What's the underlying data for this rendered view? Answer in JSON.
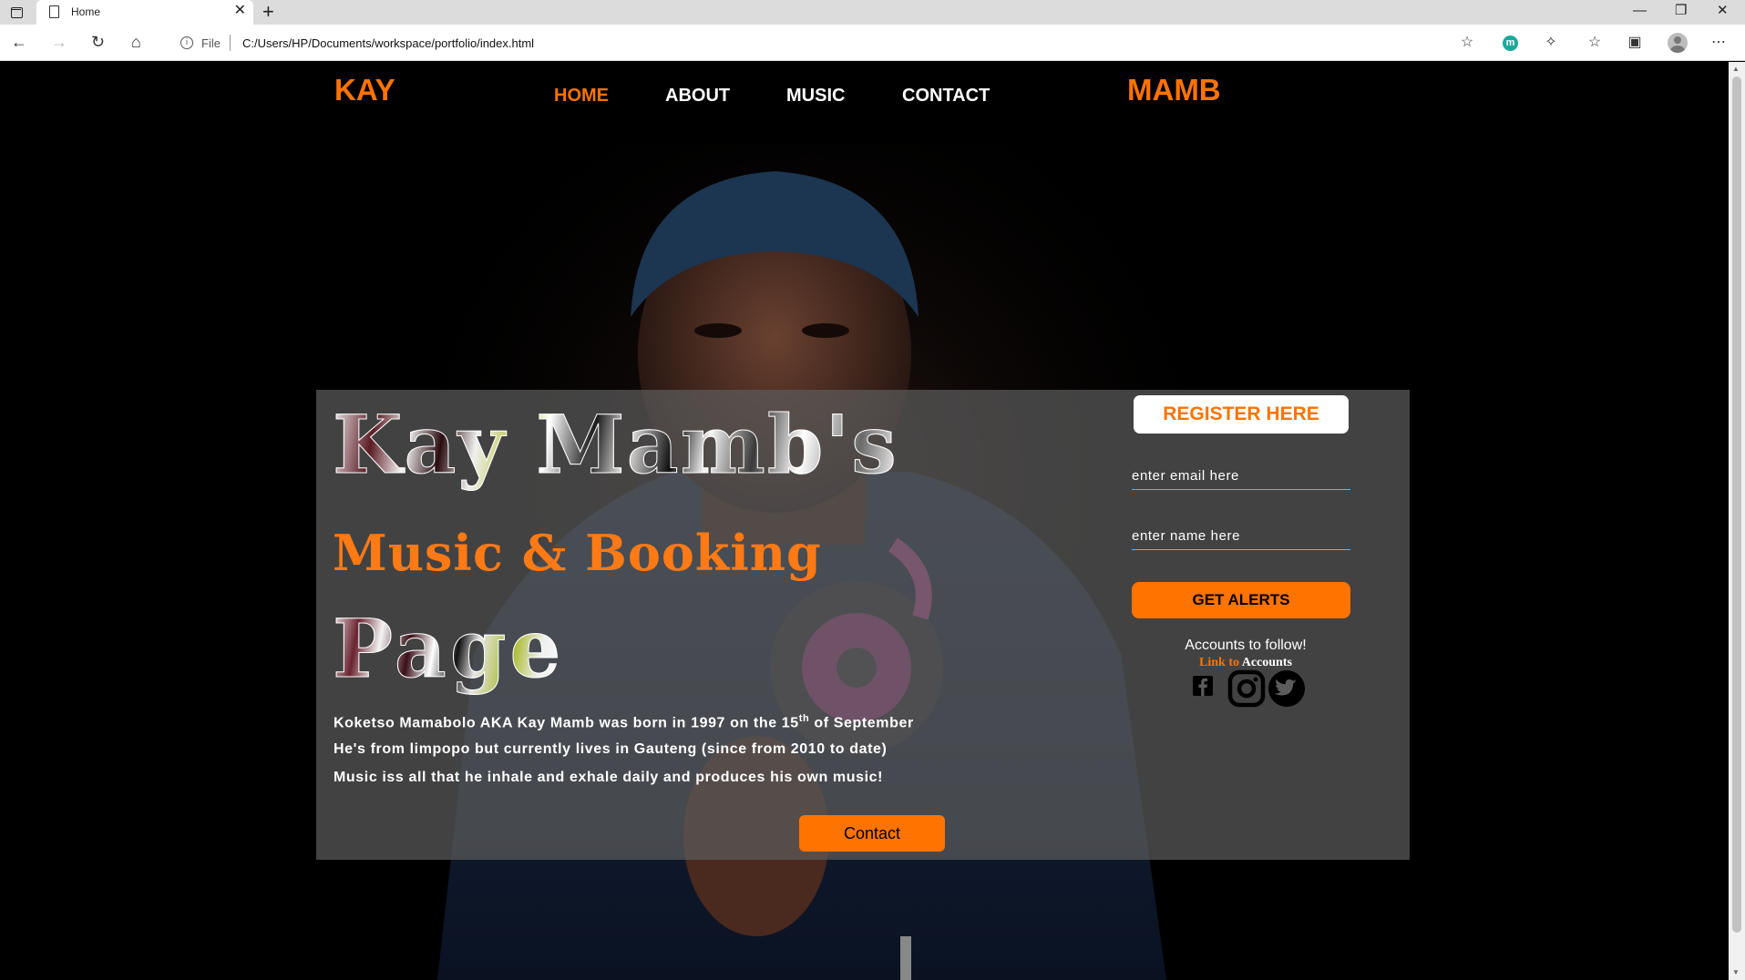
{
  "browser": {
    "tab_title": "Home",
    "url_scheme": "File",
    "url": "C:/Users/HP/Documents/workspace/portfolio/index.html",
    "extension_letter": "m",
    "glyphs": {
      "tab_close": "✕",
      "new_tab": "+",
      "minimize": "—",
      "restore": "❐",
      "close": "✕",
      "back": "←",
      "forward": "→",
      "reload": "↻",
      "home": "⌂",
      "info": "i",
      "favorite_add": "☆",
      "extensions": "✧",
      "favorites": "☆",
      "collections": "▣",
      "more": "⋯"
    }
  },
  "site": {
    "logo_left": "KAY",
    "logo_right": "MAMB",
    "nav": [
      {
        "label": "HOME",
        "active": true
      },
      {
        "label": "ABOUT",
        "active": false
      },
      {
        "label": "MUSIC",
        "active": false
      },
      {
        "label": "CONTACT",
        "active": false
      }
    ],
    "headline_line1": "Kay Mamb's",
    "headline_line2": "Music & Booking",
    "headline_line3": "Page",
    "bio": {
      "line1_before": "Koketso Mamabolo AKA Kay Mamb was born in 1997 on the 15",
      "line1_sup": "th",
      "line1_after": " of September",
      "line2": "He's from limpopo but currently lives in Gauteng (since from 2010 to date)",
      "line3": "Music iss all that he inhale and exhale daily and produces his own music!"
    },
    "contact_button": "Contact",
    "form": {
      "register_button": "REGISTER HERE",
      "email_placeholder": "enter email here",
      "name_placeholder": "enter name here",
      "alerts_button": "GET ALERTS",
      "follow_title": "Accounts to follow!",
      "follow_link_word": "Link to",
      "follow_link_rest": " Accounts"
    },
    "social_icons": [
      "facebook-icon",
      "instagram-icon",
      "twitter-icon"
    ],
    "colors": {
      "accent": "#ff7300",
      "nav_text": "#ffffff",
      "panel": "#5c5c5c"
    }
  }
}
